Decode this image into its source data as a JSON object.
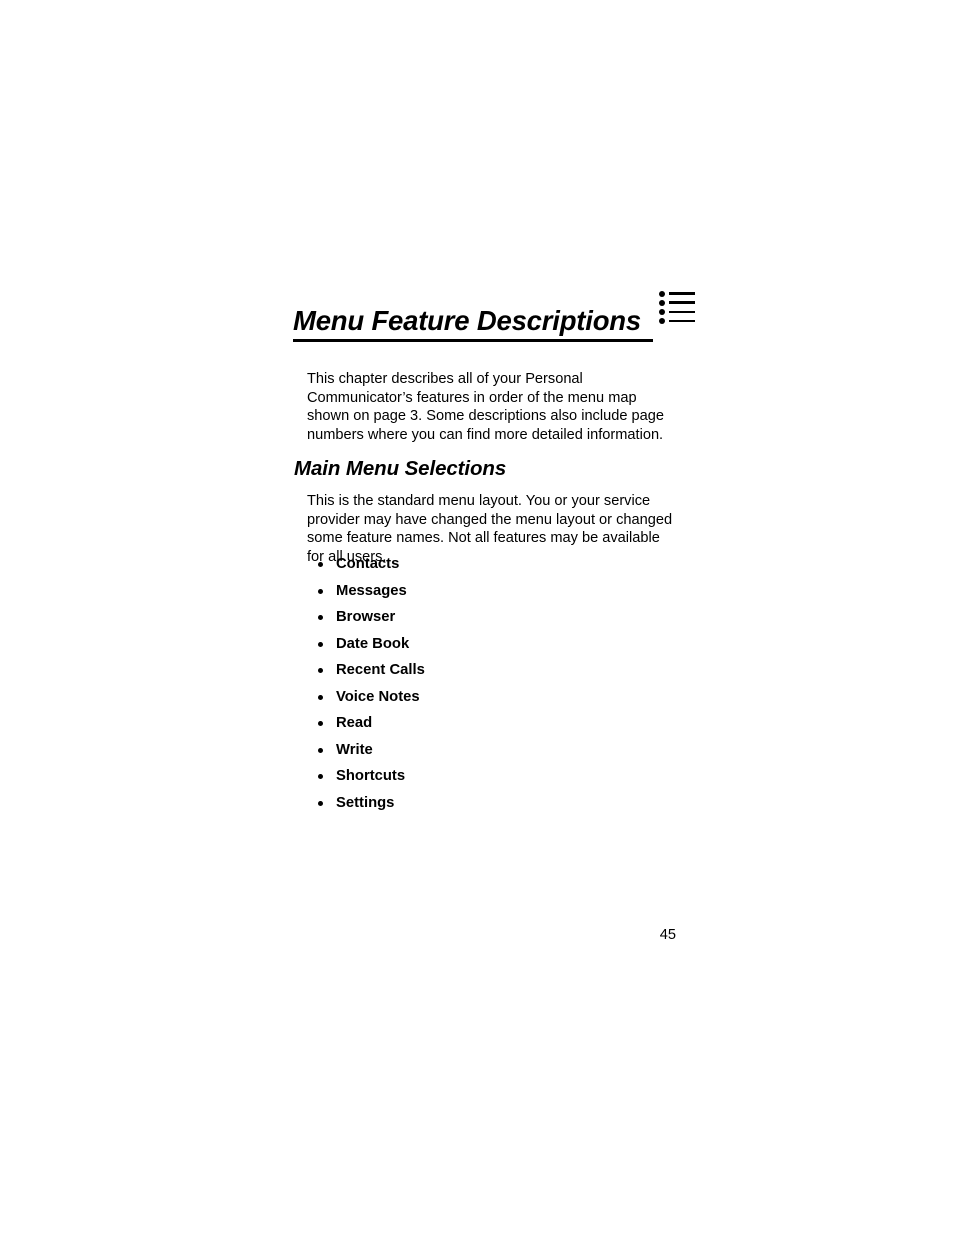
{
  "page": {
    "chapter_title": "Menu Feature Descriptions",
    "header_icon": "bulleted-list-icon",
    "page_number": "45"
  },
  "intro": {
    "paragraph": "This chapter describes all of your Personal Communicator’s features in order of the menu map shown on page 3. Some descriptions also include page numbers where you can find more detailed information."
  },
  "section": {
    "heading": "Main Menu Selections",
    "paragraph": "This is the standard menu layout. You or your service provider may have changed the menu layout or changed some feature names. Not all features may be available for all users.",
    "items": [
      {
        "label": "Contacts"
      },
      {
        "label": "Messages"
      },
      {
        "label": "Browser"
      },
      {
        "label": "Date Book"
      },
      {
        "label": "Recent Calls"
      },
      {
        "label": "Voice Notes"
      },
      {
        "label": "Read"
      },
      {
        "label": "Write"
      },
      {
        "label": "Shortcuts"
      },
      {
        "label": "Settings"
      }
    ]
  },
  "colors": {
    "text": "#000000",
    "rule": "#000000",
    "background": "#ffffff"
  }
}
